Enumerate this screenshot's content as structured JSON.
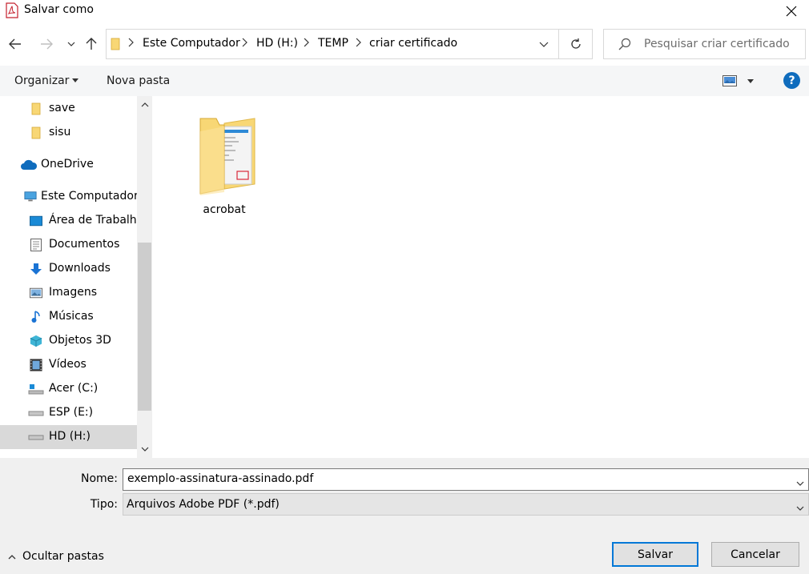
{
  "window": {
    "title": "Salvar como",
    "app_icon": "pdf-icon"
  },
  "address": {
    "crumbs": [
      "Este Computador",
      "HD (H:)",
      "TEMP",
      "criar certificado"
    ]
  },
  "search": {
    "placeholder": "Pesquisar criar certificado"
  },
  "toolbar": {
    "organize_label": "Organizar",
    "new_folder_label": "Nova pasta",
    "help_label": "?"
  },
  "sidebar": {
    "items": [
      {
        "label": "save",
        "icon": "folder-icon"
      },
      {
        "label": "sisu",
        "icon": "folder-icon"
      },
      {
        "label": "OneDrive",
        "icon": "cloud-icon"
      },
      {
        "label": "Este Computador",
        "icon": "computer-icon"
      },
      {
        "label": "Área de Trabalho",
        "icon": "desktop-icon"
      },
      {
        "label": "Documentos",
        "icon": "documents-icon"
      },
      {
        "label": "Downloads",
        "icon": "downloads-icon"
      },
      {
        "label": "Imagens",
        "icon": "pictures-icon"
      },
      {
        "label": "Músicas",
        "icon": "music-icon"
      },
      {
        "label": "Objetos 3D",
        "icon": "objects-3d-icon"
      },
      {
        "label": "Vídeos",
        "icon": "videos-icon"
      },
      {
        "label": "Acer (C:)",
        "icon": "drive-icon"
      },
      {
        "label": "ESP (E:)",
        "icon": "drive-icon"
      },
      {
        "label": "HD (H:)",
        "icon": "drive-icon"
      }
    ]
  },
  "files": [
    {
      "name": "acrobat",
      "icon": "folder-icon"
    }
  ],
  "form": {
    "name_label": "Nome:",
    "name_value": "exemplo-assinatura-assinado.pdf",
    "type_label": "Tipo:",
    "type_value": "Arquivos Adobe PDF (*.pdf)"
  },
  "footer": {
    "hide_folders_label": "Ocultar pastas",
    "save_label": "Salvar",
    "cancel_label": "Cancelar"
  },
  "colors": {
    "accent": "#0078d7",
    "selection": "#cce8ff",
    "folder": "#f8d775"
  }
}
